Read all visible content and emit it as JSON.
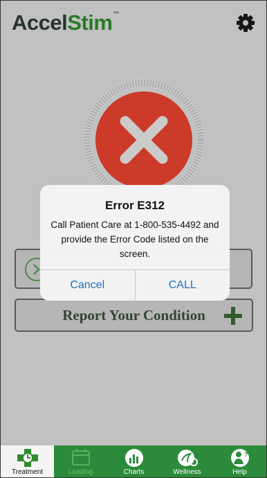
{
  "app": {
    "logo_part1": "Accel",
    "logo_part2": "Stim",
    "logo_tm": "™"
  },
  "report": {
    "label": "Report Your Condition"
  },
  "dialog": {
    "title": "Error E312",
    "message": "Call Patient Care at 1-800-535-4492 and provide the Error Code listed on the screen.",
    "cancel_label": "Cancel",
    "call_label": "CALL"
  },
  "tabs": [
    {
      "label": "Treatment",
      "state": "active"
    },
    {
      "label": "Loading",
      "state": "disabled"
    },
    {
      "label": "Charts",
      "state": "normal"
    },
    {
      "label": "Wellness",
      "state": "normal"
    },
    {
      "label": "Help",
      "state": "normal"
    }
  ],
  "icons": {
    "settings": "gear-icon",
    "status": "error-x-icon",
    "report": "plus-icon"
  },
  "colors": {
    "brand_green": "#2e8b2e",
    "tabbar_green": "#2b8b3a",
    "error_red": "#e9432f",
    "link_blue": "#1e6fb8"
  }
}
